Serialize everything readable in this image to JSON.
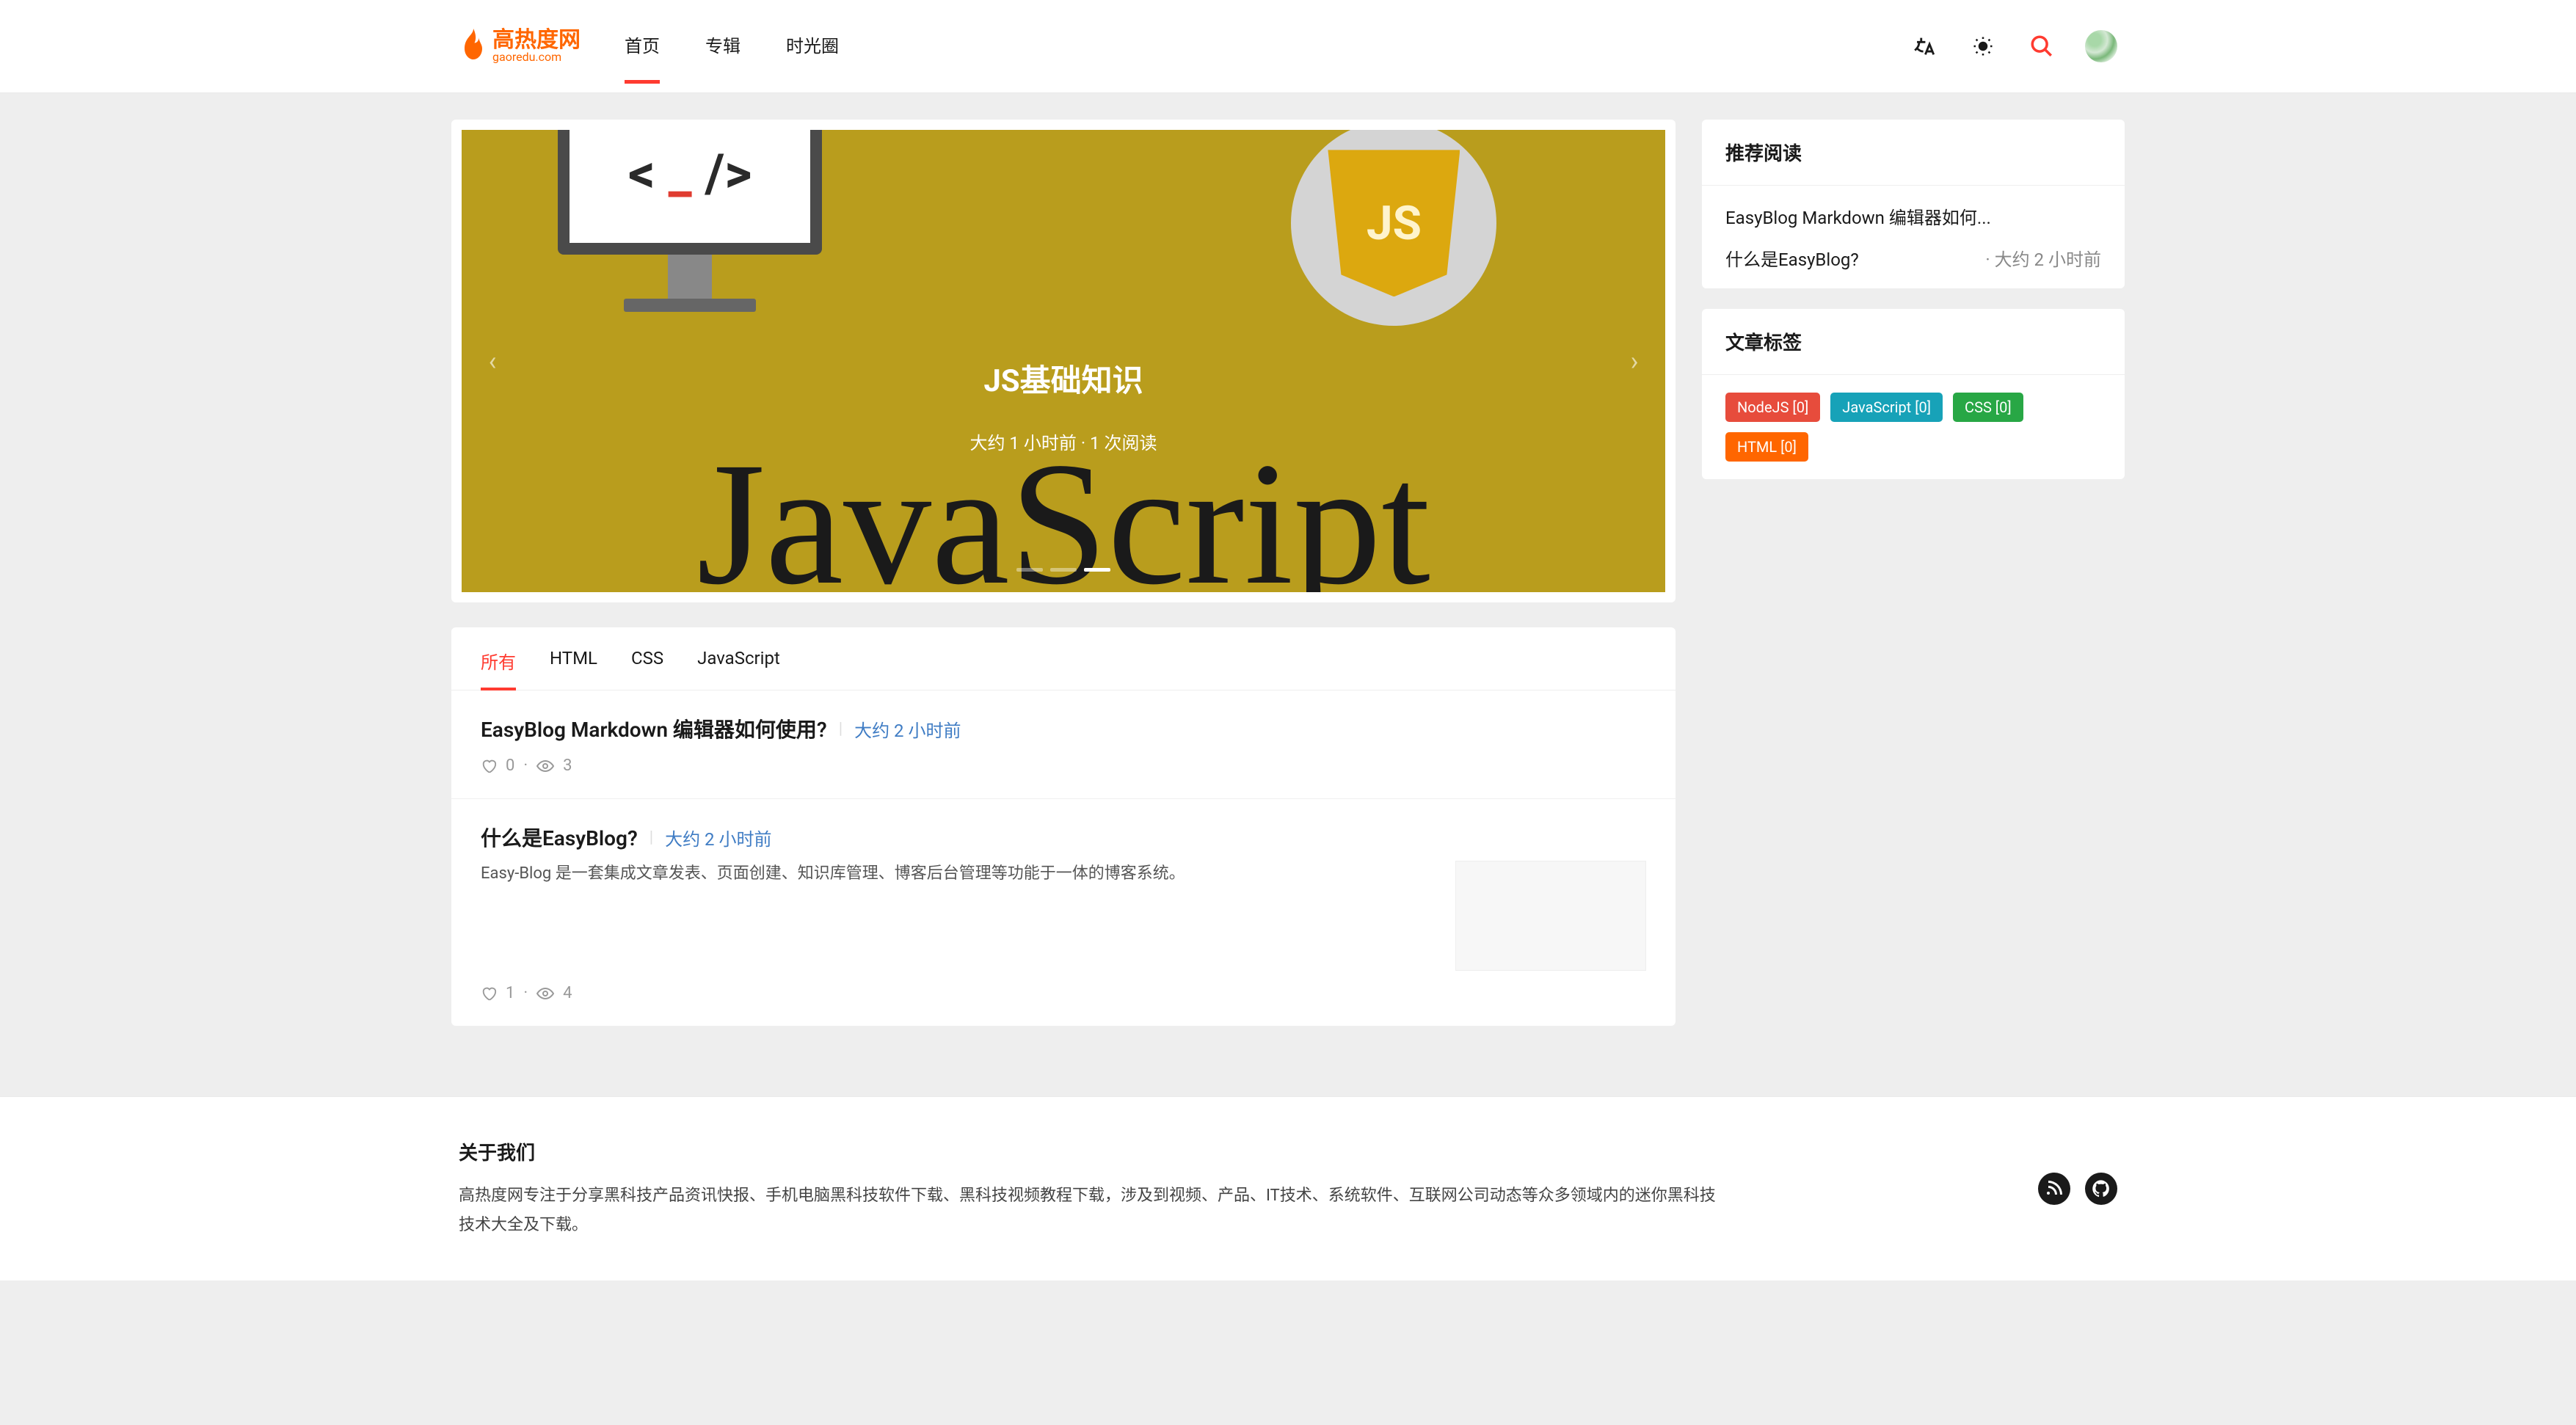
{
  "site": {
    "name_cn": "高热度网",
    "name_en": "gaoredu.com"
  },
  "nav": {
    "items": [
      "首页",
      "专辑",
      "时光圈"
    ],
    "active_index": 0
  },
  "carousel": {
    "title": "JS基础知识",
    "meta": "大约 1 小时前 · 1 次阅读",
    "slide_count": 3,
    "active_dot": 2,
    "js_badge_text": "JS",
    "bg_text": "JavaScript",
    "code_symbol": "< _ / >"
  },
  "tabs": {
    "items": [
      "所有",
      "HTML",
      "CSS",
      "JavaScript"
    ],
    "active_index": 0
  },
  "posts": [
    {
      "title": "EasyBlog Markdown 编辑器如何使用?",
      "time": "大约 2 小时前",
      "excerpt": "",
      "likes": "0",
      "views": "3",
      "has_thumb": false
    },
    {
      "title": "什么是EasyBlog?",
      "time": "大约 2 小时前",
      "excerpt": "Easy-Blog 是一套集成文章发表、页面创建、知识库管理、博客后台管理等功能于一体的博客系统。",
      "likes": "1",
      "views": "4",
      "has_thumb": true
    }
  ],
  "sidebar": {
    "recommended": {
      "title": "推荐阅读",
      "items": [
        {
          "title": "EasyBlog Markdown 编辑器如何...",
          "time": ""
        },
        {
          "title": "什么是EasyBlog?",
          "time": "· 大约 2 小时前"
        }
      ]
    },
    "tags": {
      "title": "文章标签",
      "items": [
        {
          "label": "NodeJS [0]",
          "color": "#e74c3c"
        },
        {
          "label": "JavaScript [0]",
          "color": "#17a2b8"
        },
        {
          "label": "CSS [0]",
          "color": "#28a745"
        },
        {
          "label": "HTML [0]",
          "color": "#ff6600"
        }
      ]
    }
  },
  "footer": {
    "title": "关于我们",
    "text": "高热度网专注于分享黑科技产品资讯快报、手机电脑黑科技软件下载、黑科技视频教程下载，涉及到视频、产品、IT技术、系统软件、互联网公司动态等众多领域内的迷你黑科技技术大全及下载。"
  }
}
